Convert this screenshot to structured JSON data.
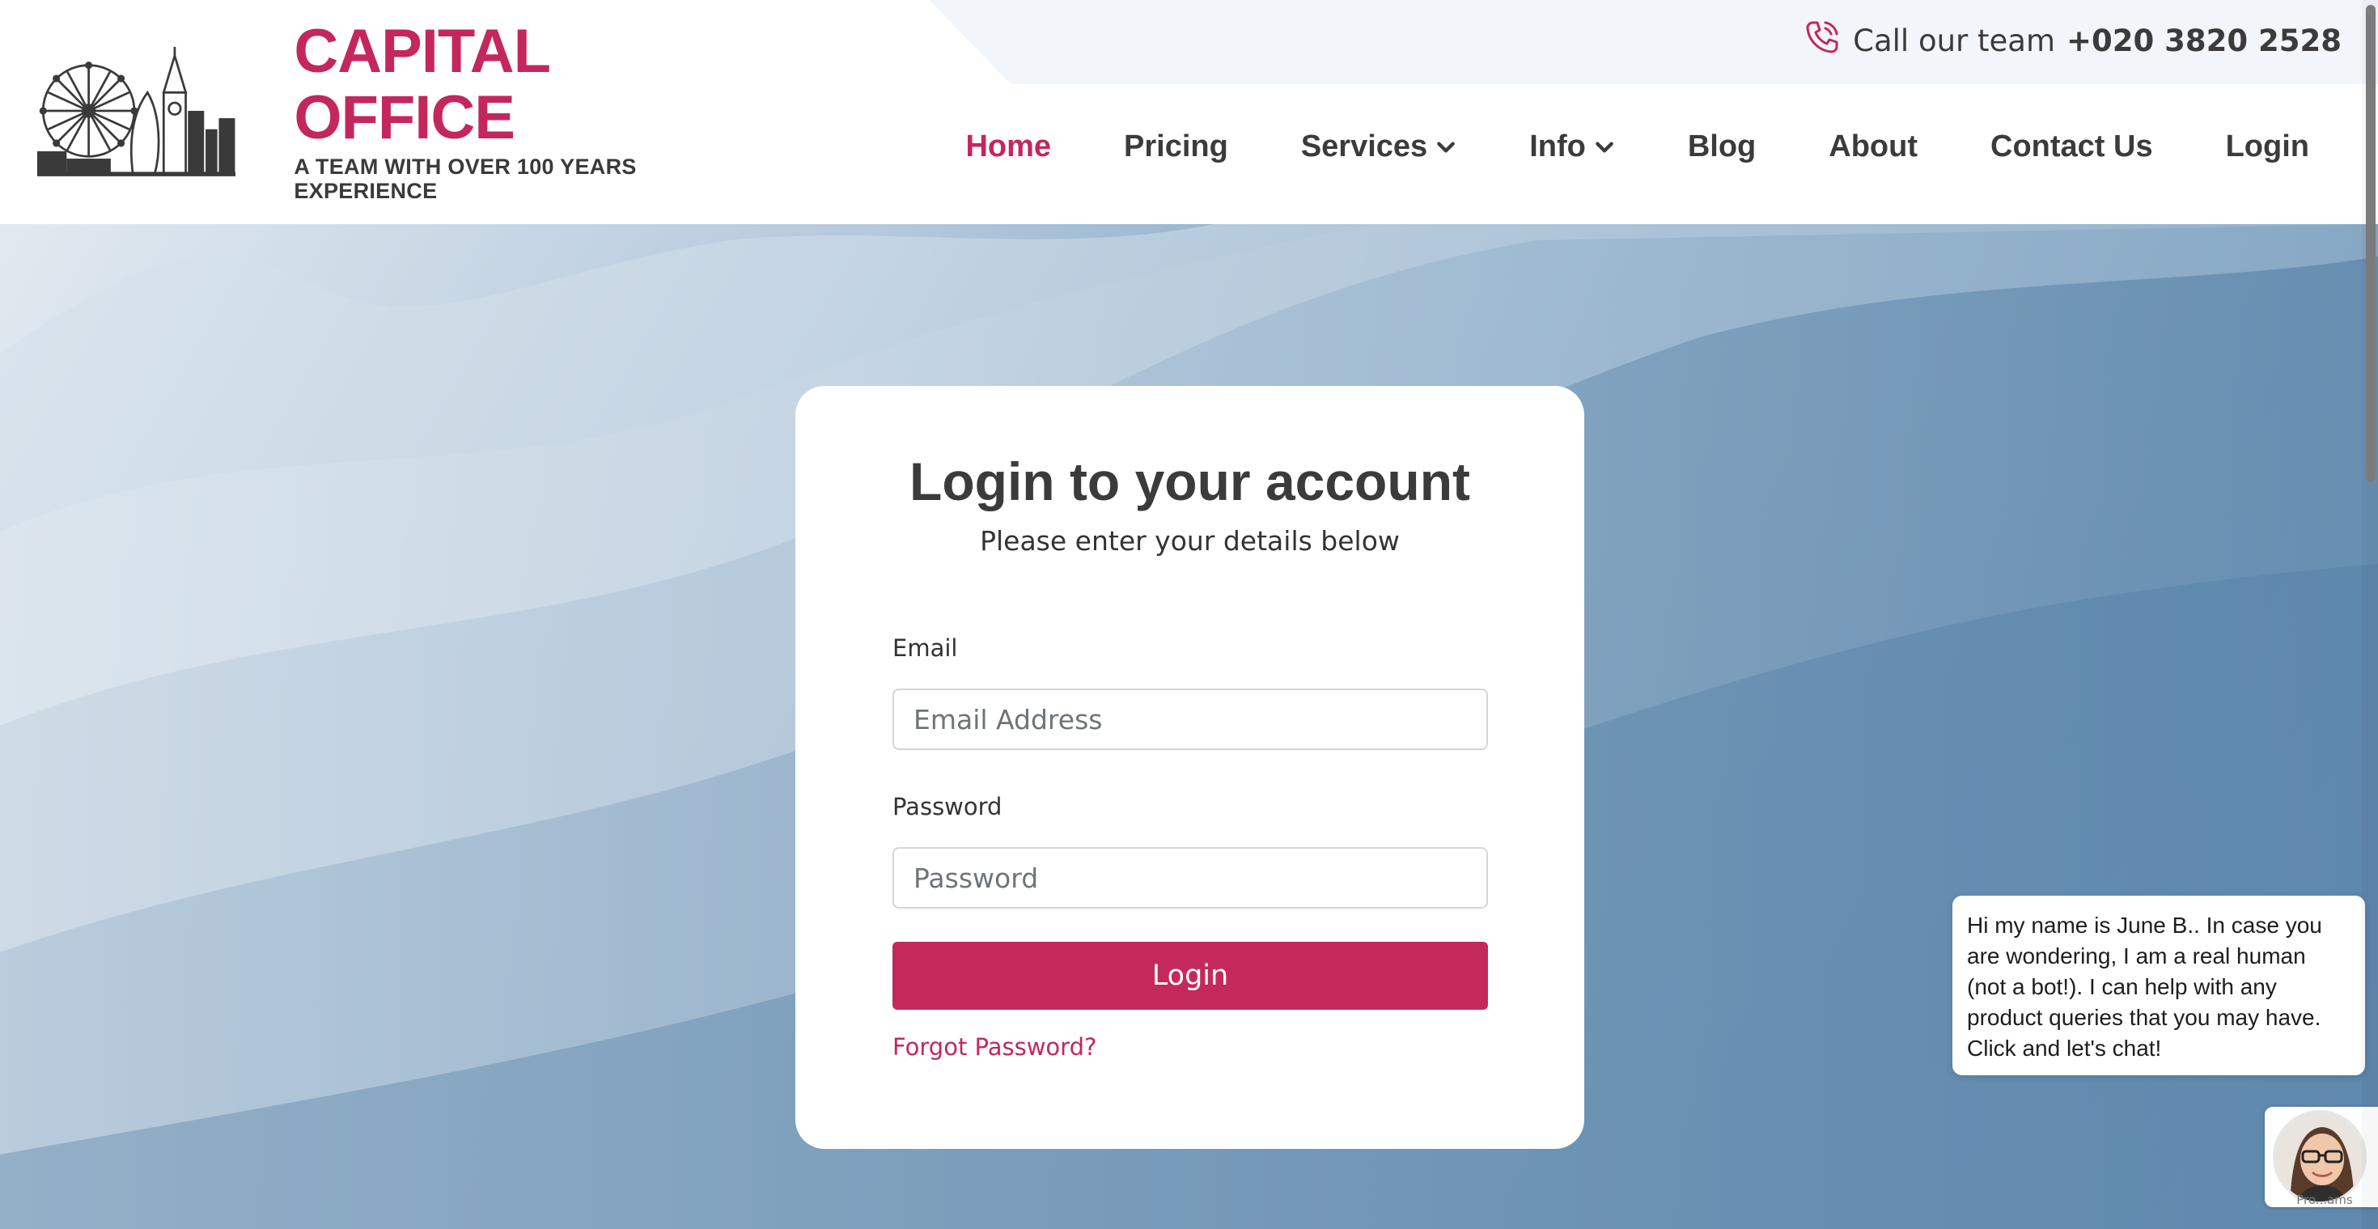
{
  "header": {
    "call_label": "Call our team",
    "phone_number": "+020 3820 2528",
    "logo_title": "CAPITAL OFFICE",
    "logo_tagline": "A TEAM WITH OVER 100 YEARS EXPERIENCE"
  },
  "nav": {
    "items": [
      {
        "label": "Home",
        "active": true
      },
      {
        "label": "Pricing"
      },
      {
        "label": "Services",
        "has_dropdown": true
      },
      {
        "label": "Info",
        "has_dropdown": true
      },
      {
        "label": "Blog"
      },
      {
        "label": "About"
      },
      {
        "label": "Contact Us"
      },
      {
        "label": "Login"
      }
    ]
  },
  "login": {
    "title": "Login to your account",
    "subtitle": "Please enter your details below",
    "email_label": "Email",
    "email_placeholder": "Email Address",
    "password_label": "Password",
    "password_placeholder": "Password",
    "button_label": "Login",
    "forgot_label": "Forgot Password?"
  },
  "chat": {
    "message": "Hi my name is June B.. In case you are wondering, I am a real human (not a bot!). I can help with any product queries that you may have. Click and let's chat!",
    "avatar_caption": "Pro...ams"
  },
  "colors": {
    "brand": "#c4275b",
    "text_dark": "#3b3b3b",
    "topbar_bg": "#f2f5f9"
  },
  "icons": {
    "phone": "phone-ringing-icon",
    "chevron": "chevron-down-icon"
  }
}
